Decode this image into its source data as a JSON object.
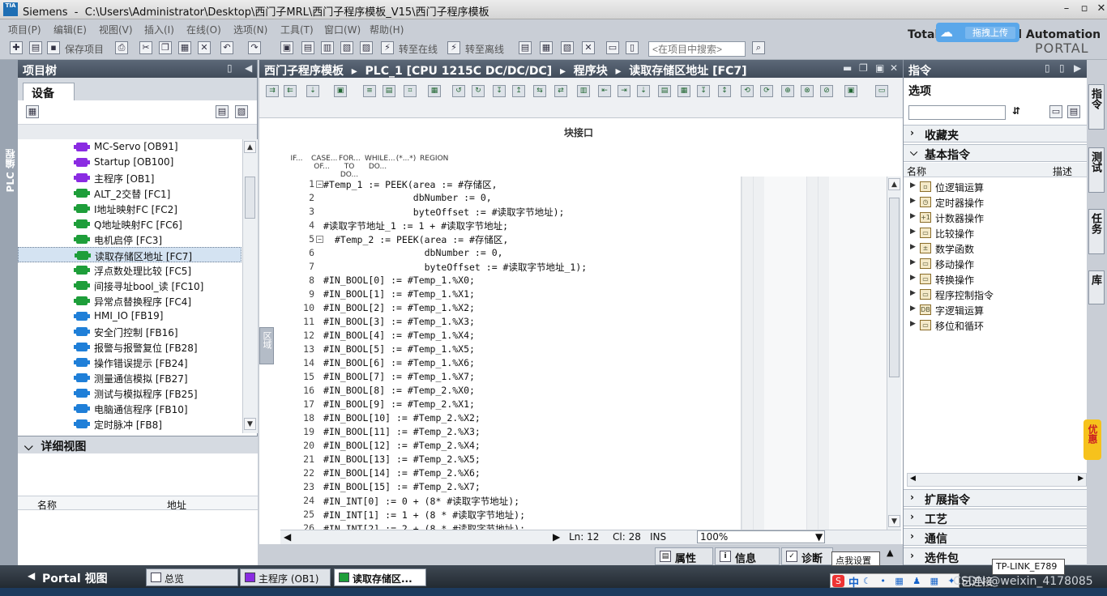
{
  "window": {
    "app": "Siemens",
    "path": "C:\\Users\\Administrator\\Desktop\\西门子MRL\\西门子程序模板_V15\\西门子程序模板",
    "logo": "TIA"
  },
  "menu": [
    "项目(P)",
    "编辑(E)",
    "视图(V)",
    "插入(I)",
    "在线(O)",
    "选项(N)",
    "工具(T)",
    "窗口(W)",
    "帮助(H)"
  ],
  "toolbar": {
    "save_label": "保存项目",
    "go_online": "转至在线",
    "go_offline": "转至离线",
    "search_placeholder": "<在项目中搜索>"
  },
  "brand": {
    "line1": "Totally Integrated Automation",
    "line2": "PORTAL",
    "upload": "拖拽上传"
  },
  "left_strip": {
    "label": "PLC 编程"
  },
  "project_tree": {
    "title": "项目树",
    "devices_tab": "设备",
    "items": [
      {
        "label": "MC-Servo [OB91]",
        "color": "#8a2be2"
      },
      {
        "label": "Startup [OB100]",
        "color": "#8a2be2"
      },
      {
        "label": "主程序 [OB1]",
        "color": "#8a2be2"
      },
      {
        "label": "ALT_2交替 [FC1]",
        "color": "#1e9e3a"
      },
      {
        "label": "I地址映射FC [FC2]",
        "color": "#1e9e3a"
      },
      {
        "label": "Q地址映射FC [FC6]",
        "color": "#1e9e3a"
      },
      {
        "label": "电机启停 [FC3]",
        "color": "#1e9e3a"
      },
      {
        "label": "读取存储区地址 [FC7]",
        "color": "#1e9e3a",
        "selected": true
      },
      {
        "label": "浮点数处理比较 [FC5]",
        "color": "#1e9e3a"
      },
      {
        "label": "间接寻址bool_读 [FC10]",
        "color": "#1e9e3a"
      },
      {
        "label": "异常点替换程序 [FC4]",
        "color": "#1e9e3a"
      },
      {
        "label": "HMI_IO [FB19]",
        "color": "#1f7fd8"
      },
      {
        "label": "安全门控制 [FB16]",
        "color": "#1f7fd8"
      },
      {
        "label": "报警与报警复位 [FB28]",
        "color": "#1f7fd8"
      },
      {
        "label": "操作错误提示 [FB24]",
        "color": "#1f7fd8"
      },
      {
        "label": "测量通信模拟 [FB27]",
        "color": "#1f7fd8"
      },
      {
        "label": "测试与模拟程序 [FB25]",
        "color": "#1f7fd8"
      },
      {
        "label": "电脑通信程序 [FB10]",
        "color": "#1f7fd8"
      },
      {
        "label": "定时脉冲 [FB8]",
        "color": "#1f7fd8"
      }
    ]
  },
  "detail_view": {
    "title": "详细视图",
    "col_name": "名称",
    "col_address": "地址"
  },
  "editor": {
    "breadcrumb": [
      "西门子程序模板",
      "PLC_1 [CPU 1215C DC/DC/DC]",
      "程序块",
      "读取存储区地址 [FC7]"
    ],
    "interface_label": "块接口",
    "scl_buttons": [
      "IF...",
      "CASE... OF...",
      "FOR... TO DO...",
      "WHILE... DO...",
      "(*...*)",
      "REGION"
    ],
    "side_tab": "区域",
    "code_lines": [
      "#Temp_1 := PEEK(area := #存储区,",
      "                dbNumber := 0,",
      "                byteOffset := #读取字节地址);",
      "#读取字节地址_1 := 1 + #读取字节地址;",
      "  #Temp_2 := PEEK(area := #存储区,",
      "                  dbNumber := 0,",
      "                  byteOffset := #读取字节地址_1);",
      "#IN_BOOL[0] := #Temp_1.%X0;",
      "#IN_BOOL[1] := #Temp_1.%X1;",
      "#IN_BOOL[2] := #Temp_1.%X2;",
      "#IN_BOOL[3] := #Temp_1.%X3;",
      "#IN_BOOL[4] := #Temp_1.%X4;",
      "#IN_BOOL[5] := #Temp_1.%X5;",
      "#IN_BOOL[6] := #Temp_1.%X6;",
      "#IN_BOOL[7] := #Temp_1.%X7;",
      "#IN_BOOL[8] := #Temp_2.%X0;",
      "#IN_BOOL[9] := #Temp_2.%X1;",
      "#IN_BOOL[10] := #Temp_2.%X2;",
      "#IN_BOOL[11] := #Temp_2.%X3;",
      "#IN_BOOL[12] := #Temp_2.%X4;",
      "#IN_BOOL[13] := #Temp_2.%X5;",
      "#IN_BOOL[14] := #Temp_2.%X6;",
      "#IN_BOOL[15] := #Temp_2.%X7;",
      "#IN_INT[0] := 0 + (8* #读取字节地址);",
      "#IN_INT[1] := 1 + (8 * #读取字节地址);",
      "#IN_INT[2] := 2 + (8 * #读取字节地址);"
    ],
    "status": {
      "ln": "Ln: 12",
      "cl": "Cl: 28",
      "mode": "INS",
      "zoom": "100%"
    },
    "bottom_tabs": {
      "properties": "属性",
      "info": "信息",
      "diagnostics": "诊断"
    }
  },
  "instructions": {
    "title": "指令",
    "options": "选项",
    "favorites": "收藏夹",
    "basic": "基本指令",
    "col_name": "名称",
    "col_desc": "描述",
    "items": [
      "位逻辑运算",
      "定时器操作",
      "计数器操作",
      "比较操作",
      "数学函数",
      "移动操作",
      "转换操作",
      "程序控制指令",
      "字逻辑运算",
      "移位和循环"
    ],
    "extended": "扩展指令",
    "technology": "工艺",
    "communication": "通信",
    "option_packages": "选件包"
  },
  "right_tabs": [
    "指令",
    "测试",
    "任务",
    "库"
  ],
  "promo": "优惠",
  "portal": {
    "view": "Portal 视图",
    "tabs": [
      "总览",
      "主程序 (OB1)",
      "读取存储区..."
    ]
  },
  "tooltips": {
    "settings": "点我设置",
    "network": "TP-LINK_E789"
  },
  "system": {
    "connected": "已连接",
    "watermark": "CSDN @weixin_4178085"
  }
}
